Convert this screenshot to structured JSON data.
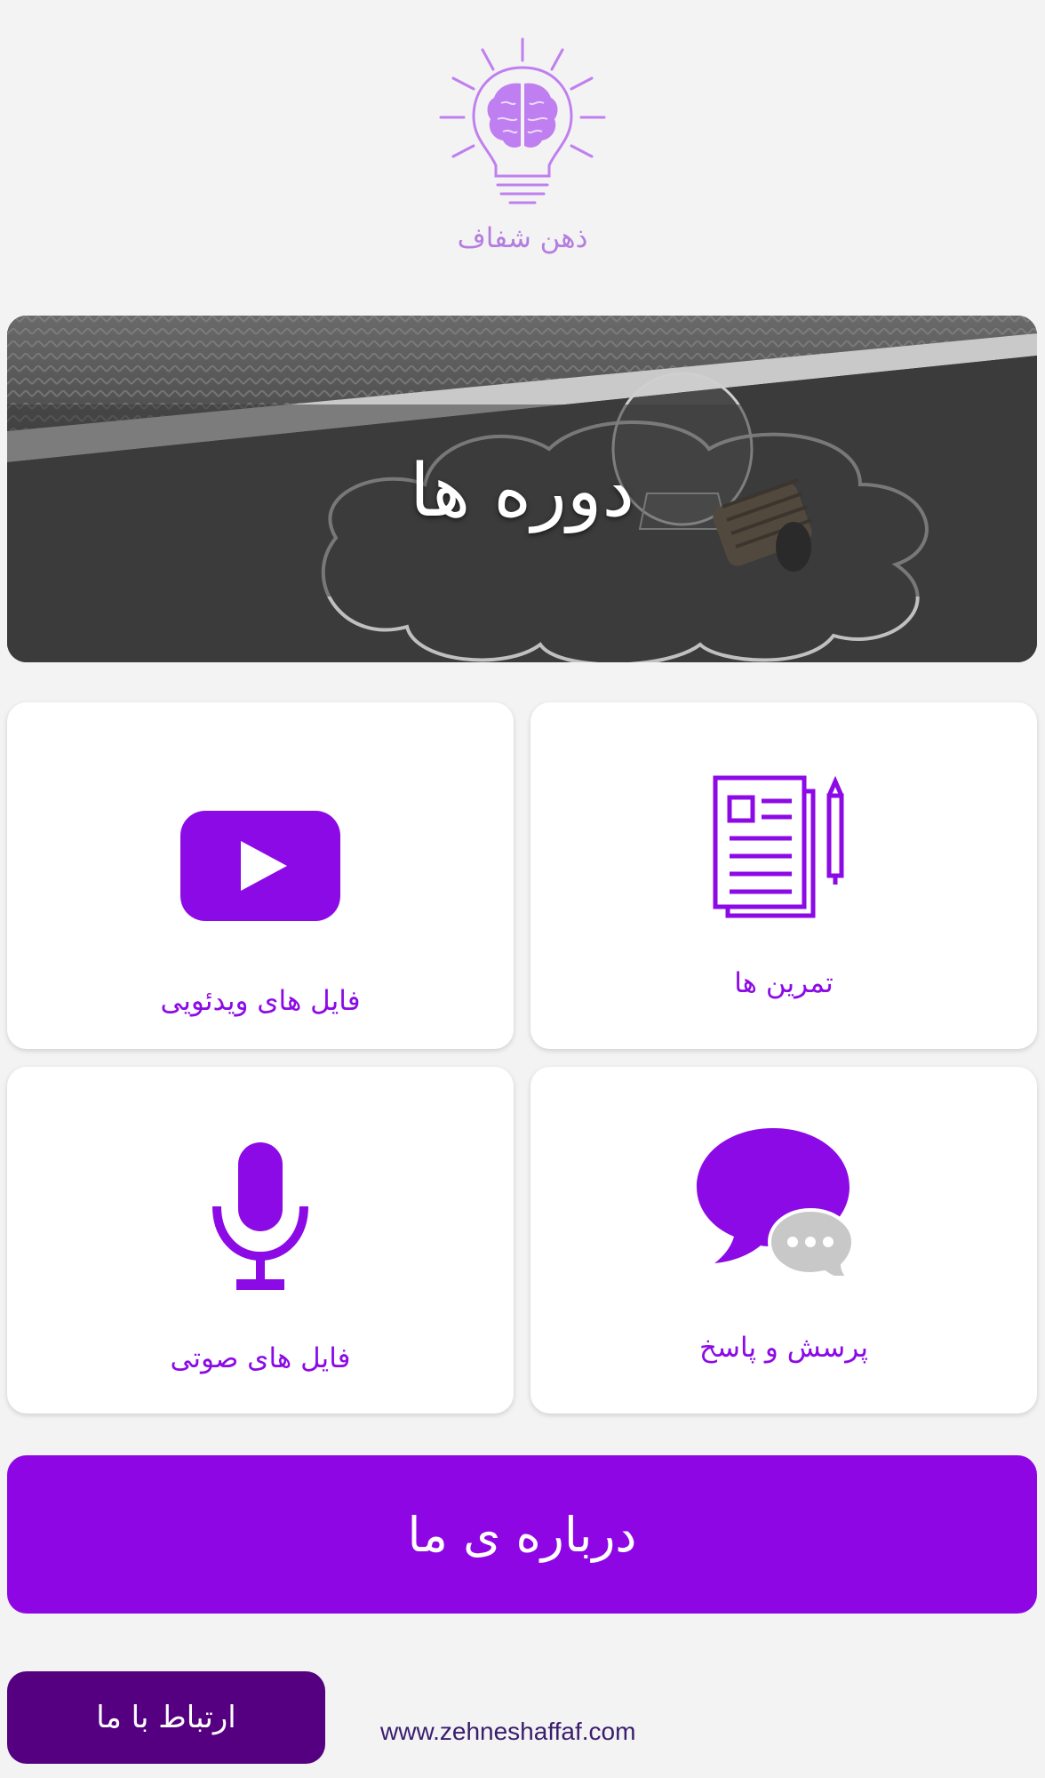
{
  "brand": {
    "name": "ذهن شفاف",
    "logo_icon": "brain-lightbulb-icon",
    "logo_color": "#c07ff0"
  },
  "hero": {
    "title": "دوره ها"
  },
  "cards": [
    {
      "label": "فایل های ویدئویی",
      "icon": "video-play-icon"
    },
    {
      "label": "تمرین ها",
      "icon": "document-pen-icon"
    },
    {
      "label": "فایل های صوتی",
      "icon": "microphone-icon"
    },
    {
      "label": "پرسش و پاسخ",
      "icon": "chat-bubbles-icon"
    }
  ],
  "about_button": {
    "label": "درباره ی ما"
  },
  "contact_button": {
    "label": "ارتباط با ما"
  },
  "website": "www.zehneshaffaf.com",
  "colors": {
    "accent": "#8f06e5",
    "dark_accent": "#540080",
    "background": "#f3f3f3"
  }
}
